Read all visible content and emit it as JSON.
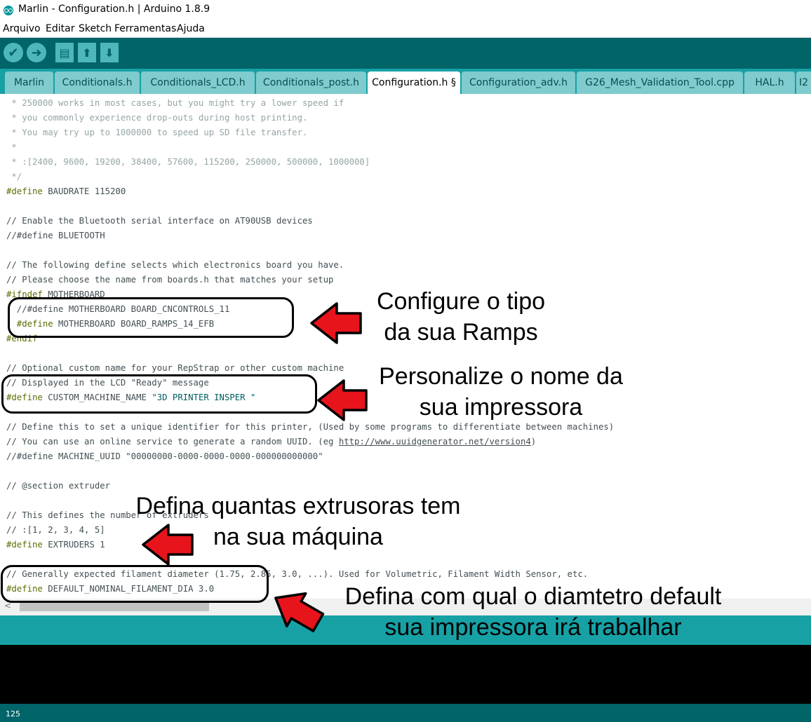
{
  "window": {
    "title": "Marlin - Configuration.h | Arduino 1.8.9"
  },
  "menu": [
    "Arquivo",
    "Editar",
    "Sketch",
    "Ferramentas",
    "Ajuda"
  ],
  "toolbar": {
    "verify": "✔",
    "upload": "➜",
    "new": "▤",
    "open": "⬆",
    "save": "⬇"
  },
  "tabs": [
    "Marlin",
    "Conditionals.h",
    "Conditionals_LCD.h",
    "Conditionals_post.h",
    "Configuration.h §",
    "Configuration_adv.h",
    "G26_Mesh_Validation_Tool.cpp",
    "HAL.h",
    "I2"
  ],
  "code": {
    "l01": " * 250000 works in most cases, but you might try a lower speed if",
    "l02": " * you commonly experience drop-outs during host printing.",
    "l03": " * You may try up to 1000000 to speed up SD file transfer.",
    "l04": " *",
    "l05": " * :[2400, 9600, 19200, 38400, 57600, 115200, 250000, 500000, 1000000]",
    "l06": " */",
    "l07_kw": "#define",
    "l07_rest": " BAUDRATE 115200",
    "l09": "// Enable the Bluetooth serial interface on AT90USB devices",
    "l10": "//#define BLUETOOTH",
    "l12": "// The following define selects which electronics board you have.",
    "l13": "// Please choose the name from boards.h that matches your setup",
    "l14_kw": "#ifndef",
    "l14_rest": " MOTHERBOARD",
    "l15": "  //#define MOTHERBOARD BOARD_CNCONTROLS_11",
    "l16_kw": "  #define",
    "l16_rest": " MOTHERBOARD BOARD_RAMPS_14_EFB",
    "l17_kw": "#endif",
    "l19": "// Optional custom name for your RepStrap or other custom machine",
    "l20": "// Displayed in the LCD \"Ready\" message",
    "l21_kw": "#define",
    "l21_rest": " CUSTOM_MACHINE_NAME ",
    "l21_str": "\"3D PRINTER INSPER \"",
    "l23": "// Define this to set a unique identifier for this printer, (Used by some programs to differentiate between machines)",
    "l24_pre": "// You can use an online service to generate a random UUID. (eg ",
    "l24_link": "http://www.uuidgenerator.net/version4",
    "l24_post": ")",
    "l25": "//#define MACHINE_UUID \"00000000-0000-0000-0000-000000000000\"",
    "l27": "// @section extruder",
    "l29": "// This defines the number of extruders",
    "l30": "// :[1, 2, 3, 4, 5]",
    "l31_kw": "#define",
    "l31_rest": " EXTRUDERS 1",
    "l33": "// Generally expected filament diameter (1.75, 2.85, 3.0, ...). Used for Volumetric, Filament Width Sensor, etc.",
    "l34_kw": "#define",
    "l34_rest": " DEFAULT_NOMINAL_FILAMENT_DIA 3.0"
  },
  "hscroll_arrow": "<",
  "status": {
    "line_number": "125"
  },
  "annotations": {
    "a1_line1": "Configure o tipo",
    "a1_line2": "da sua Ramps",
    "a2_line1": "Personalize o nome da",
    "a2_line2": "sua impressora",
    "a3_line1": "Defina quantas extrusoras tem",
    "a3_line2": "na sua máquina",
    "a4_line1": "Defina com qual o diamtetro default",
    "a4_line2": "sua impressora irá trabalhar"
  },
  "colors": {
    "teal_dark": "#006468",
    "teal_mid": "#17a1a5",
    "tab_bg": "#7fcbcd",
    "arrow_red": "#e8141b",
    "keyword": "#5e6d03",
    "comment": "#95a5a6"
  }
}
